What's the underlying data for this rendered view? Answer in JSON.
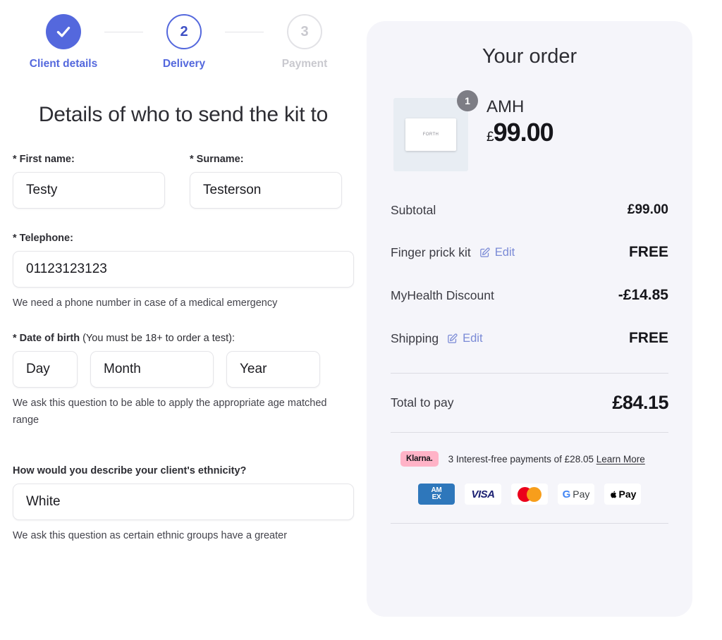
{
  "stepper": {
    "steps": [
      {
        "label": "Client details",
        "marker": "check",
        "state": "done"
      },
      {
        "label": "Delivery",
        "marker": "2",
        "state": "current"
      },
      {
        "label": "Payment",
        "marker": "3",
        "state": "todo"
      }
    ]
  },
  "form": {
    "title": "Details of who to send the kit to",
    "first_name": {
      "label_star": "* ",
      "label": "First name:",
      "value": "Testy"
    },
    "surname": {
      "label_star": "* ",
      "label": "Surname:",
      "value": "Testerson"
    },
    "telephone": {
      "label_star": "* ",
      "label": "Telephone:",
      "value": "01123123123",
      "helper": "We need a phone number in case of a medical emergency"
    },
    "dob": {
      "label_star": "* ",
      "label_bold": "Date of birth",
      "label_rest": " (You must be 18+ to order a test):",
      "day": "Day",
      "month": "Month",
      "year": "Year",
      "helper": "We ask this question to be able to apply the appropriate age matched range"
    },
    "ethnicity": {
      "label": "How would you describe your client's ethnicity?",
      "value": "White",
      "helper": "We ask this question as certain ethnic groups have a greater"
    }
  },
  "order": {
    "title": "Your order",
    "product": {
      "name": "AMH",
      "currency": "£",
      "price": "99.00",
      "quantity": "1",
      "thumb_logo": "FORTH"
    },
    "lines": [
      {
        "label": "Subtotal",
        "edit": null,
        "value": "£99.00"
      },
      {
        "label": "Finger prick kit",
        "edit": "Edit",
        "value": "FREE"
      },
      {
        "label": "MyHealth Discount",
        "edit": null,
        "value": "-£14.85"
      },
      {
        "label": "Shipping",
        "edit": "Edit",
        "value": "FREE"
      }
    ],
    "total": {
      "label": "Total to pay",
      "value": "£84.15"
    },
    "klarna": {
      "badge": "Klarna.",
      "text": "3 Interest-free payments of £28.05 ",
      "learn_more": "Learn More"
    },
    "payment_logos": [
      {
        "name": "amex",
        "line1": "AM",
        "line2": "EX"
      },
      {
        "name": "visa",
        "text": "VISA"
      },
      {
        "name": "mastercard",
        "text": ""
      },
      {
        "name": "gpay",
        "g": "G",
        "text": "Pay"
      },
      {
        "name": "applepay",
        "text": "Pay"
      }
    ]
  }
}
